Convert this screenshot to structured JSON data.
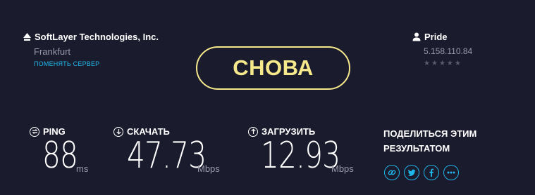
{
  "server": {
    "name": "SoftLayer Technologies, Inc.",
    "city": "Frankfurt",
    "change_label": "ПОМЕНЯТЬ СЕРВЕР"
  },
  "again_button": {
    "label": "СНОВА"
  },
  "isp": {
    "name": "Pride",
    "ip": "5.158.110.84",
    "rating": 0,
    "rating_max": 5
  },
  "metrics": {
    "ping": {
      "label": "PING",
      "value": "88",
      "unit": "ms"
    },
    "download": {
      "label": "СКАЧАТЬ",
      "value": "47.73",
      "unit": "Mbps"
    },
    "upload": {
      "label": "ЗАГРУЗИТЬ",
      "value": "12.93",
      "unit": "Mbps"
    }
  },
  "share": {
    "title": "ПОДЕЛИТЬСЯ ЭТИМ РЕЗУЛЬТАТОМ",
    "icons": [
      "link-icon",
      "twitter-icon",
      "facebook-icon",
      "more-icon"
    ]
  },
  "colors": {
    "background": "#1b1b2e",
    "accent_yellow": "#f6e98c",
    "accent_blue": "#1fb7e8",
    "muted_text": "#9a9aaa"
  }
}
